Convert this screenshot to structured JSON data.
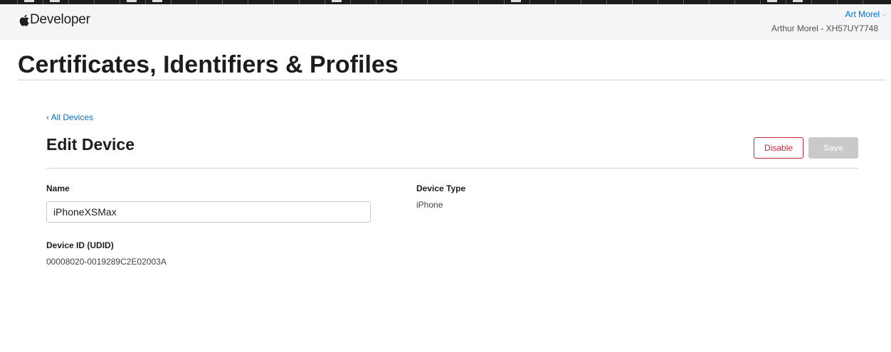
{
  "header": {
    "brand": "Developer",
    "user_menu_label": "Art Morel",
    "account_info": "Arthur Morel - XH57UY7748"
  },
  "page": {
    "title": "Certificates, Identifiers & Profiles"
  },
  "device_edit": {
    "back_link": "‹ All Devices",
    "title": "Edit Device",
    "disable_label": "Disable",
    "save_label": "Save",
    "name_label": "Name",
    "name_value": "iPhoneXSMax",
    "device_type_label": "Device Type",
    "device_type_value": "iPhone",
    "udid_label": "Device ID (UDID)",
    "udid_value": "00008020-0019289C2E02003A"
  },
  "colors": {
    "link": "#0070c9",
    "danger": "#c4283b",
    "disabled": "#c9c9cc"
  }
}
